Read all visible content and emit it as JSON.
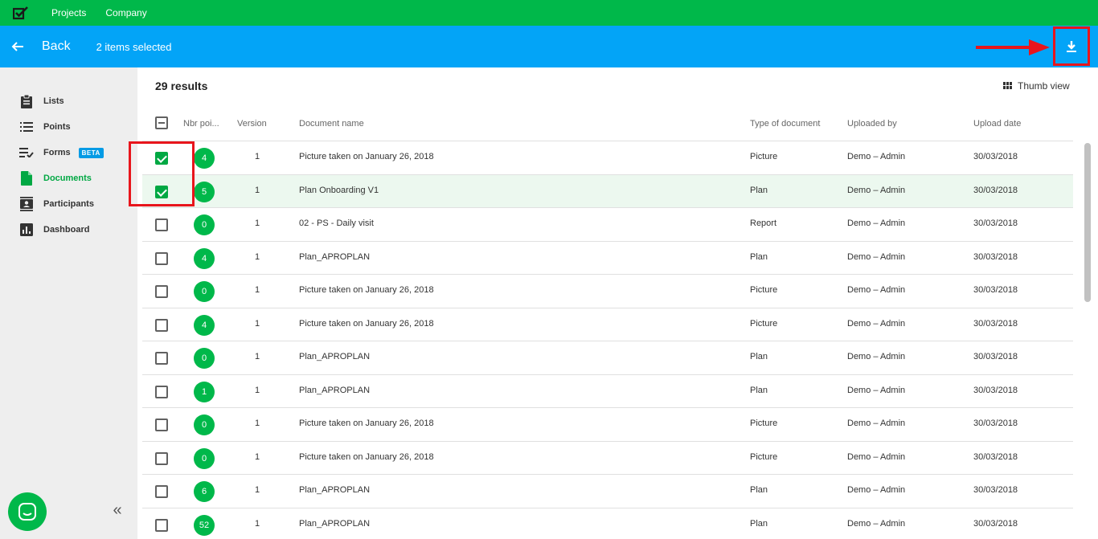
{
  "topbar": {
    "logo_icon": "checkbox-logo-icon",
    "nav": [
      "Projects",
      "Company"
    ]
  },
  "actionbar": {
    "back_label": "Back",
    "selected_text": "2 items selected",
    "download_icon": "download-icon"
  },
  "sidebar": {
    "items": [
      {
        "label": "Lists",
        "icon": "clipboard-icon",
        "active": false
      },
      {
        "label": "Points",
        "icon": "list-icon",
        "active": false
      },
      {
        "label": "Forms",
        "icon": "checklist-icon",
        "active": false,
        "badge": "BETA"
      },
      {
        "label": "Documents",
        "icon": "document-icon",
        "active": true
      },
      {
        "label": "Participants",
        "icon": "contacts-icon",
        "active": false
      },
      {
        "label": "Dashboard",
        "icon": "chart-icon",
        "active": false
      }
    ]
  },
  "main": {
    "results": "29 results",
    "thumb_view": "Thumb view",
    "columns": [
      "Nbr poi...",
      "Version",
      "Document name",
      "Type of document",
      "Uploaded by",
      "Upload date"
    ],
    "rows": [
      {
        "checked": true,
        "points": "4",
        "version": "1",
        "name": "Picture taken on January 26, 2018",
        "type": "Picture",
        "uploaded_by": "Demo – Admin",
        "date": "30/03/2018"
      },
      {
        "checked": true,
        "points": "5",
        "version": "1",
        "name": "Plan Onboarding V1",
        "type": "Plan",
        "uploaded_by": "Demo – Admin",
        "date": "30/03/2018"
      },
      {
        "checked": false,
        "points": "0",
        "version": "1",
        "name": "02 - PS - Daily visit",
        "type": "Report",
        "uploaded_by": "Demo – Admin",
        "date": "30/03/2018"
      },
      {
        "checked": false,
        "points": "4",
        "version": "1",
        "name": "Plan_APROPLAN",
        "type": "Plan",
        "uploaded_by": "Demo – Admin",
        "date": "30/03/2018"
      },
      {
        "checked": false,
        "points": "0",
        "version": "1",
        "name": "Picture taken on January 26, 2018",
        "type": "Picture",
        "uploaded_by": "Demo – Admin",
        "date": "30/03/2018"
      },
      {
        "checked": false,
        "points": "4",
        "version": "1",
        "name": "Picture taken on January 26, 2018",
        "type": "Picture",
        "uploaded_by": "Demo – Admin",
        "date": "30/03/2018"
      },
      {
        "checked": false,
        "points": "0",
        "version": "1",
        "name": "Plan_APROPLAN",
        "type": "Plan",
        "uploaded_by": "Demo – Admin",
        "date": "30/03/2018"
      },
      {
        "checked": false,
        "points": "1",
        "version": "1",
        "name": "Plan_APROPLAN",
        "type": "Plan",
        "uploaded_by": "Demo – Admin",
        "date": "30/03/2018"
      },
      {
        "checked": false,
        "points": "0",
        "version": "1",
        "name": "Picture taken on January 26, 2018",
        "type": "Picture",
        "uploaded_by": "Demo – Admin",
        "date": "30/03/2018"
      },
      {
        "checked": false,
        "points": "0",
        "version": "1",
        "name": "Picture taken on January 26, 2018",
        "type": "Picture",
        "uploaded_by": "Demo – Admin",
        "date": "30/03/2018"
      },
      {
        "checked": false,
        "points": "6",
        "version": "1",
        "name": "Plan_APROPLAN",
        "type": "Plan",
        "uploaded_by": "Demo – Admin",
        "date": "30/03/2018"
      },
      {
        "checked": false,
        "points": "52",
        "version": "1",
        "name": "Plan_APROPLAN",
        "type": "Plan",
        "uploaded_by": "Demo – Admin",
        "date": "30/03/2018"
      }
    ]
  },
  "colors": {
    "topbar": "#00b84a",
    "actionbar": "#03a4f7",
    "accent_green": "#00a843",
    "annotation_red": "#e8151c",
    "beta_badge": "#039be5"
  }
}
